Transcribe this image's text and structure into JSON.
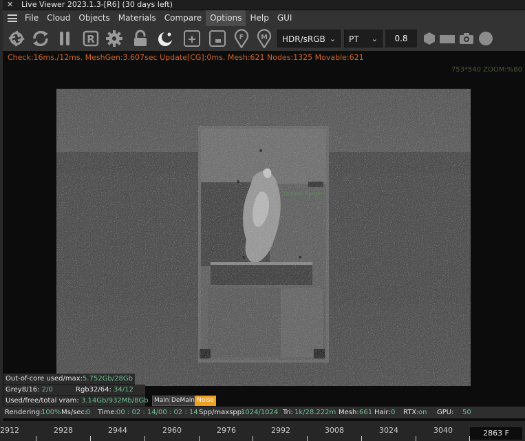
{
  "window": {
    "title": "Live Viewer 2023.1.3-[R6] (30 days left)",
    "close_glyph": "✕"
  },
  "menu": [
    {
      "label": "File",
      "active": false
    },
    {
      "label": "Cloud",
      "active": false
    },
    {
      "label": "Objects",
      "active": false
    },
    {
      "label": "Materials",
      "active": false
    },
    {
      "label": "Compare",
      "active": false
    },
    {
      "label": "Options",
      "active": true
    },
    {
      "label": "Help",
      "active": false
    },
    {
      "label": "GUI",
      "active": false
    }
  ],
  "toolbar": {
    "icons": [
      "aperture-icon",
      "refresh-icon",
      "pause-icon",
      "r-box-icon",
      "gear-icon",
      "lock-icon",
      "sphere-icon",
      "add-box-icon",
      "minus-box-icon",
      "pin-f-icon",
      "pin-m-icon"
    ],
    "color_mode": "HDR/sRGB",
    "kernel": "PT",
    "value": "0.8",
    "right_icons": [
      "hexagon-icon",
      "rectangle-icon",
      "camera-icon",
      "circle-icon"
    ]
  },
  "stats_line": "Check:16ms./12ms. MeshGen:3.607sec Update[CG]:0ms. Mesh:621 Nodes:1325 Movable:621",
  "zoom_line": "753*540 ZOOM:%80",
  "render": {
    "label_overlay": "Octane Render"
  },
  "info": {
    "out_of_core_label": "Out-of-core used/max:",
    "out_of_core_value": "5.752Gb/28Gb",
    "grey_label": "Grey8/16:",
    "grey_value": "2/0",
    "rgb_label": "Rgb32/64:",
    "rgb_value": "34/12",
    "vram_label": "Used/free/total vram:",
    "vram_value": "3.14Gb/932Mb/8Gb",
    "tags": [
      "Main",
      "DeMain",
      "Noise"
    ]
  },
  "status": {
    "rendering_label": "Rendering:",
    "rendering_value": "100%",
    "mssec_label": "Ms/sec:",
    "mssec_value": "0",
    "time_label": "Time:",
    "time_value": "00 : 02 : 14/00 : 02 : 14",
    "spp_label": "Spp/maxspp:",
    "spp_value": "1024/1024",
    "tri_label": "Tri:",
    "tri_value": "1k/28.222m",
    "mesh_label": "Mesh:",
    "mesh_value": "661",
    "hair_label": "Hair:",
    "hair_value": "0",
    "rtx_label": "RTX:",
    "rtx_value": "on",
    "gpu_label": "GPU:",
    "gpu_value": "50"
  },
  "timeline": {
    "ticks": [
      "2912",
      "2928",
      "2944",
      "2960",
      "2976",
      "2992",
      "3008",
      "3024",
      "3040"
    ],
    "current_frame": "2863 F"
  },
  "colors": {
    "stats_orange": "#d2661e",
    "value_green": "#6fc394",
    "noise_tag": "#f0a020",
    "panel_bg": "#333333"
  }
}
